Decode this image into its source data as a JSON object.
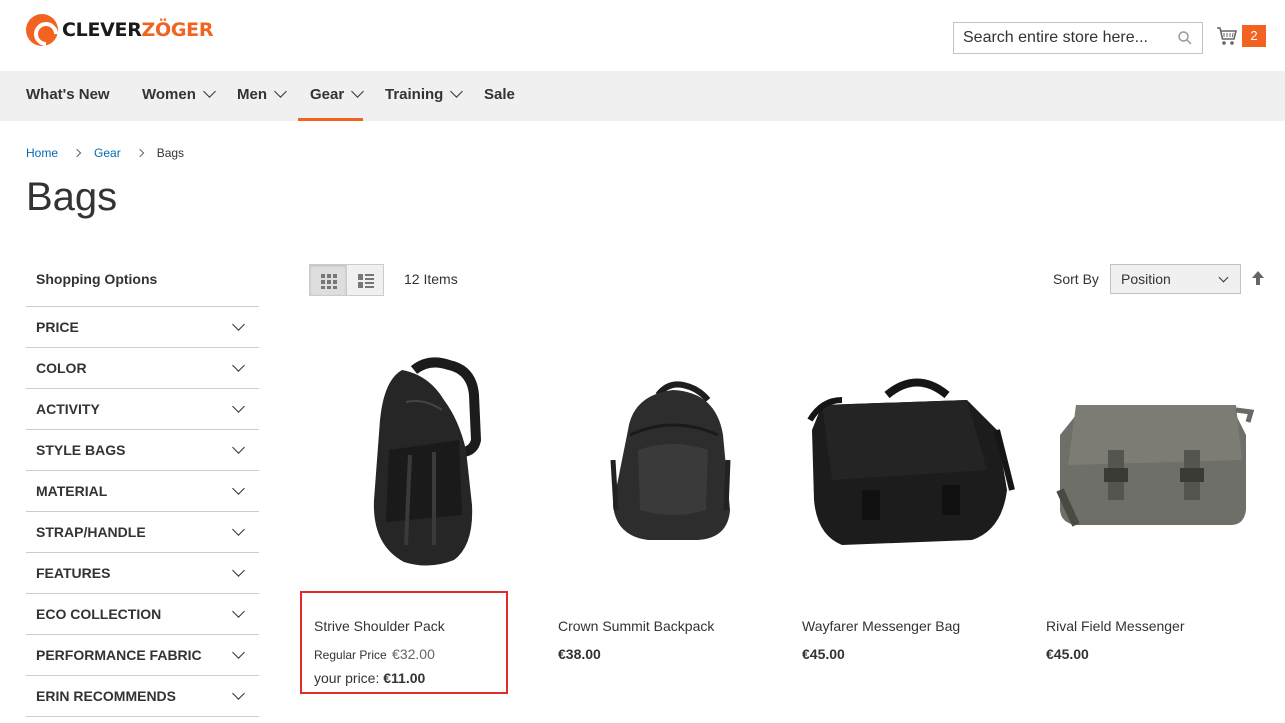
{
  "header": {
    "logo_part1": "CLEVER",
    "logo_part2": "ZÖGER",
    "search_placeholder": "Search entire store here...",
    "cart_count": "2"
  },
  "nav": {
    "items": [
      {
        "label": "What's New",
        "has_dropdown": false
      },
      {
        "label": "Women",
        "has_dropdown": true
      },
      {
        "label": "Men",
        "has_dropdown": true
      },
      {
        "label": "Gear",
        "has_dropdown": true,
        "active": true
      },
      {
        "label": "Training",
        "has_dropdown": true
      },
      {
        "label": "Sale",
        "has_dropdown": false
      }
    ]
  },
  "breadcrumb": {
    "items": [
      "Home",
      "Gear"
    ],
    "current": "Bags"
  },
  "page_title": "Bags",
  "sidebar": {
    "title": "Shopping Options",
    "filters": [
      "PRICE",
      "COLOR",
      "ACTIVITY",
      "STYLE BAGS",
      "MATERIAL",
      "STRAP/HANDLE",
      "FEATURES",
      "ECO COLLECTION",
      "PERFORMANCE FABRIC",
      "ERIN RECOMMENDS"
    ]
  },
  "toolbar": {
    "amount": "12 Items",
    "sort_label": "Sort By",
    "sort_value": "Position"
  },
  "products": [
    {
      "name": "Strive Shoulder Pack",
      "regular_label": "Regular Price",
      "regular_price": "€32.00",
      "special_label": "your price:",
      "special_price": "€11.00",
      "image": "sling-backpack-icon"
    },
    {
      "name": "Crown Summit Backpack",
      "price": "€38.00",
      "image": "backpack-icon"
    },
    {
      "name": "Wayfarer Messenger Bag",
      "price": "€45.00",
      "image": "messenger-bag-icon"
    },
    {
      "name": "Rival Field Messenger",
      "price": "€45.00",
      "image": "field-messenger-icon"
    }
  ],
  "colors": {
    "accent": "#f26322",
    "link": "#006bb4",
    "highlight": "#e02b27",
    "nav_bg": "#f0f0f0"
  }
}
